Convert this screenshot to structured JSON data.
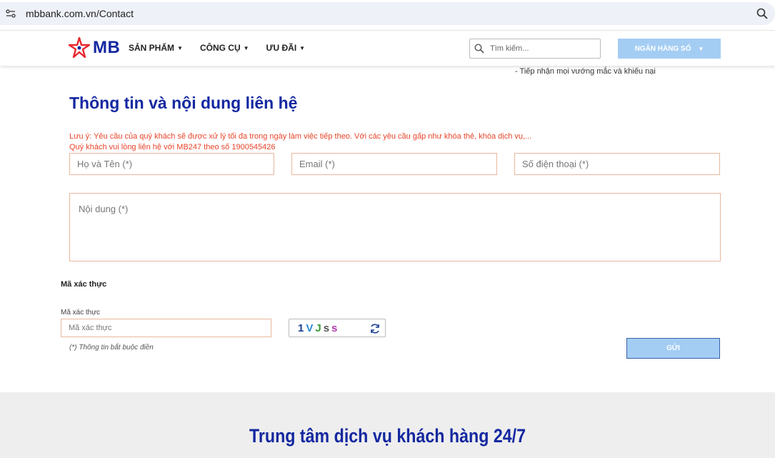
{
  "browser": {
    "url": "mbbank.com.vn/Contact"
  },
  "header": {
    "logo_text": "MB",
    "nav": [
      {
        "label": "SẢN PHẨM"
      },
      {
        "label": "CÔNG CỤ"
      },
      {
        "label": "ƯU ĐÃI"
      }
    ],
    "search_placeholder": "Tìm kiếm...",
    "digital_bank_label": "NGÂN HÀNG SỐ",
    "subnote": "- Tiếp nhận mọi vướng mắc và khiếu nại"
  },
  "form": {
    "title": "Thông tin và nội dung liên hệ",
    "note_line1": "Lưu ý: Yêu cầu của quý khách sẽ được xử lý tối đa trong ngày làm việc tiếp theo. Với các yêu cầu gấp như khóa thẻ, khóa dịch vụ,...",
    "note_line2": "Quý khách vui lòng liên hệ với MB247 theo số 1900545426",
    "name_placeholder": "Họ và Tên (*)",
    "email_placeholder": "Email (*)",
    "phone_placeholder": "Số điện thoại (*)",
    "content_placeholder": "Nội dung (*)",
    "captcha_heading": "Mã xác thực",
    "captcha_label": "Mã xác thực",
    "captcha_placeholder": "Mã xác thực",
    "captcha_chars": [
      "1",
      "V",
      "J",
      "s",
      "s"
    ],
    "required_note": "(*) Thông tin bắt buộc điền",
    "submit_label": "GỬI"
  },
  "footer": {
    "title": "Trung tâm dịch vụ khách hàng 24/7"
  },
  "colors": {
    "brand_blue": "#1428a0",
    "warning_red": "#e8442a",
    "button_light_blue": "#a4cdf4",
    "field_border": "#e7b79d"
  }
}
